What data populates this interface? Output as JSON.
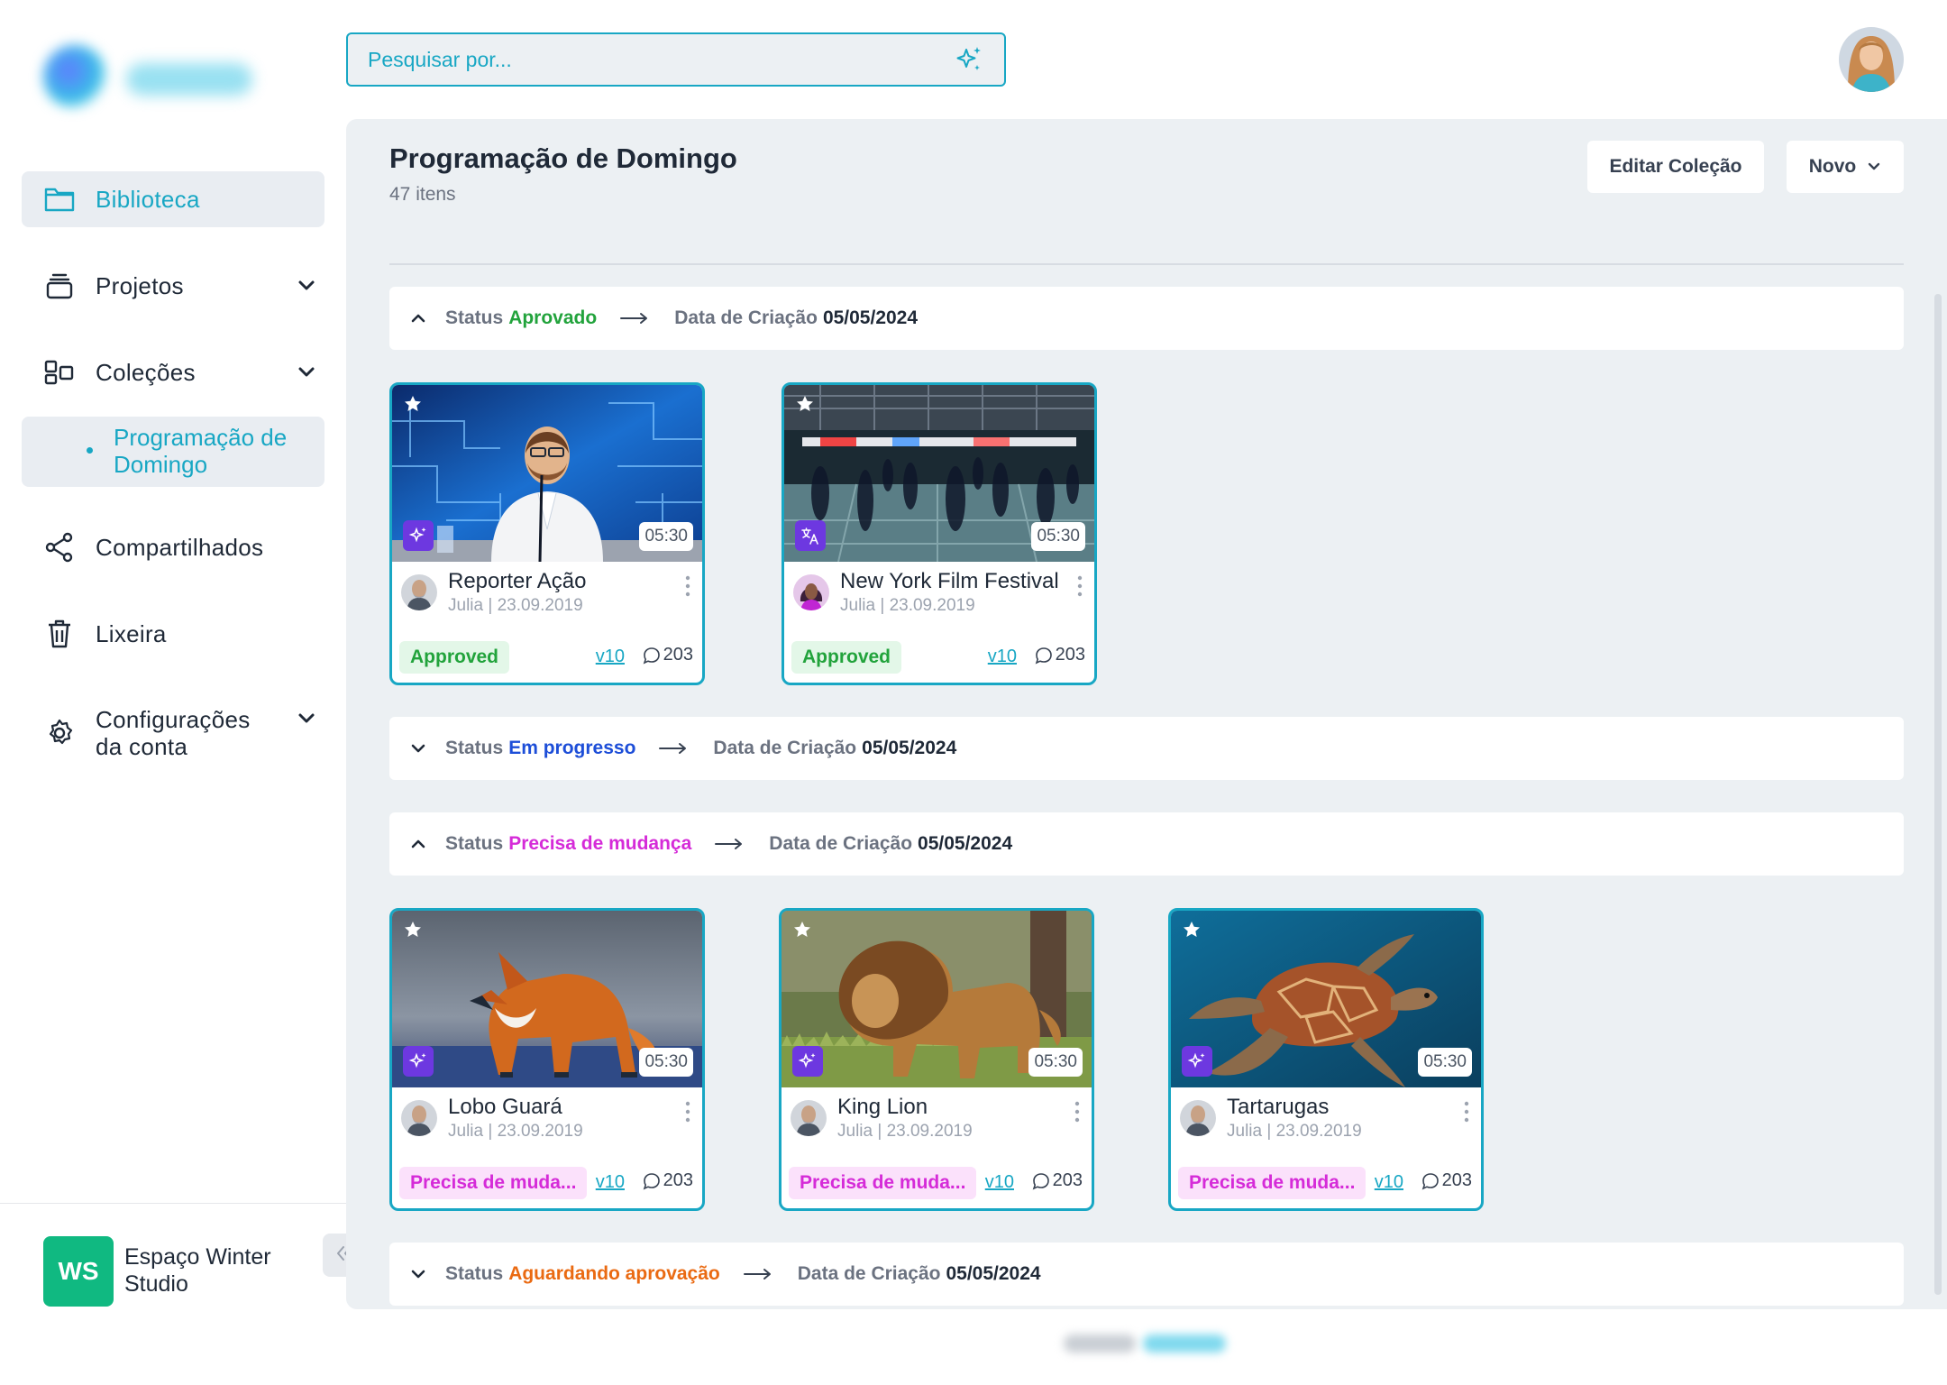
{
  "search": {
    "placeholder": "Pesquisar por..."
  },
  "sidebar": {
    "items": [
      {
        "label": "Biblioteca"
      },
      {
        "label": "Projetos"
      },
      {
        "label": "Coleções"
      },
      {
        "label": "Programação de Domingo"
      },
      {
        "label": "Compartilhados"
      },
      {
        "label": "Lixeira"
      },
      {
        "label": "Configurações da conta"
      }
    ],
    "workspace": {
      "initials": "WS",
      "name": "Espaço Winter Studio"
    }
  },
  "header": {
    "title": "Programação de Domingo",
    "subtitle": "47 itens",
    "edit_label": "Editar Coleção",
    "new_label": "Novo"
  },
  "groups": [
    {
      "status_label": "Status",
      "status_value": "Aprovado",
      "status_color": "#22a33c",
      "date_label": "Data de Criação",
      "date_value": "05/05/2024",
      "expanded": true
    },
    {
      "status_label": "Status",
      "status_value": "Em progresso",
      "status_color": "#1d4ed8",
      "date_label": "Data de Criação",
      "date_value": "05/05/2024",
      "expanded": false
    },
    {
      "status_label": "Status",
      "status_value": "Precisa de mudança",
      "status_color": "#d52bd8",
      "date_label": "Data de Criação",
      "date_value": "05/05/2024",
      "expanded": true
    },
    {
      "status_label": "Status",
      "status_value": "Aguardando aprovação",
      "status_color": "#ea6a12",
      "date_label": "Data de Criação",
      "date_value": "05/05/2024",
      "expanded": false
    }
  ],
  "cards": [
    {
      "title": "Reporter Ação",
      "meta": "Julia | 23.09.2019",
      "duration": "05:30",
      "status": "Approved",
      "version": "v10",
      "comments": "203",
      "badge_icon": "sparkle-icon"
    },
    {
      "title": "New York Film Festival",
      "meta": "Julia | 23.09.2019",
      "duration": "05:30",
      "status": "Approved",
      "version": "v10",
      "comments": "203",
      "badge_icon": "translate-icon"
    },
    {
      "title": "Lobo Guará",
      "meta": "Julia | 23.09.2019",
      "duration": "05:30",
      "status": "Precisa de muda...",
      "version": "v10",
      "comments": "203",
      "badge_icon": "sparkle-icon"
    },
    {
      "title": "King Lion",
      "meta": "Julia | 23.09.2019",
      "duration": "05:30",
      "status": "Precisa de muda...",
      "version": "v10",
      "comments": "203",
      "badge_icon": "sparkle-icon"
    },
    {
      "title": "Tartarugas",
      "meta": "Julia | 23.09.2019",
      "duration": "05:30",
      "status": "Precisa de muda...",
      "version": "v10",
      "comments": "203",
      "badge_icon": "sparkle-icon"
    }
  ],
  "colors": {
    "accent": "#18a7c4",
    "ai_badge": "#6d38e0",
    "workspace": "#10b981"
  }
}
